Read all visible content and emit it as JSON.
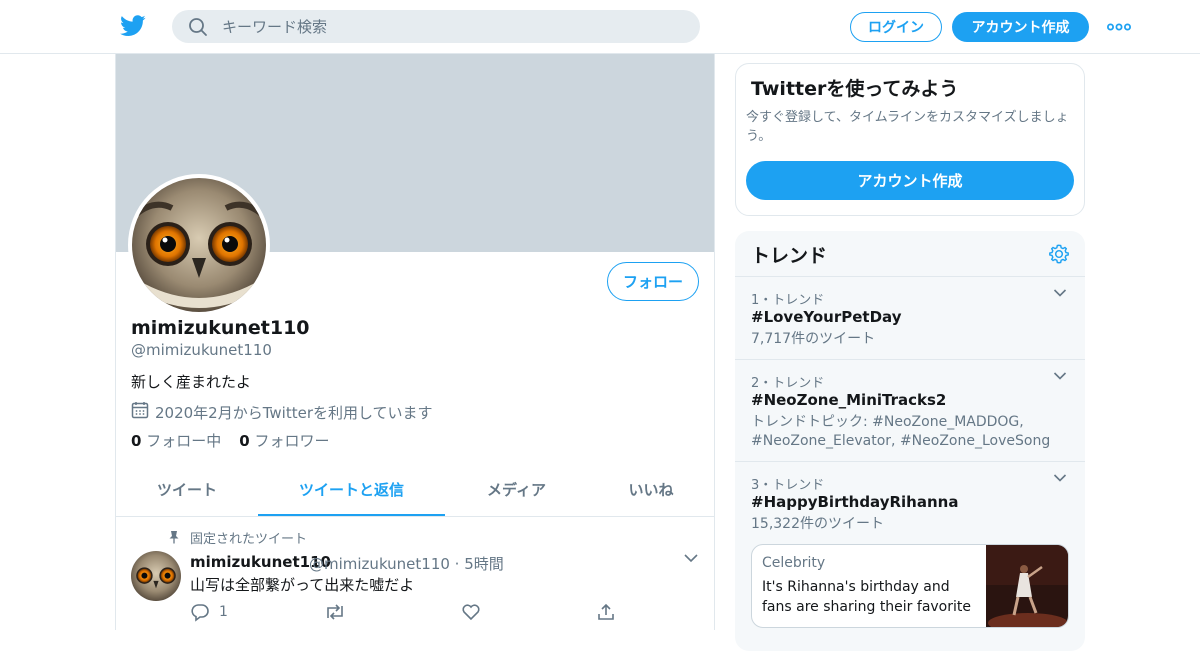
{
  "header": {
    "search_placeholder": "キーワード検索",
    "login_label": "ログイン",
    "signup_label": "アカウント作成"
  },
  "profile": {
    "display_name": "mimizukunet110",
    "handle": "@mimizukunet110",
    "bio": "新しく産まれたよ",
    "joined": "2020年2月からTwitterを利用しています",
    "following_count": "0",
    "following_label": "フォロー中",
    "followers_count": "0",
    "followers_label": "フォロワー",
    "follow_label": "フォロー"
  },
  "tabs": [
    {
      "label": "ツイート",
      "active": false
    },
    {
      "label": "ツイートと返信",
      "active": true
    },
    {
      "label": "メディア",
      "active": false
    },
    {
      "label": "いいね",
      "active": false
    }
  ],
  "tweet": {
    "pinned_label": "固定されたツイート",
    "author_name": "mimizukunet110",
    "author_meta": "@mimizukunet110 · 5時間",
    "text": "山写は全部繋がって出来た嘘だよ",
    "reply_count": "1"
  },
  "signup_card": {
    "title": "Twitterを使ってみよう",
    "description": "今すぐ登録して、タイムラインをカスタマイズしましょう。",
    "button_label": "アカウント作成"
  },
  "trends": {
    "title": "トレンド",
    "items": [
      {
        "rank": "1・トレンド",
        "name": "#LoveYourPetDay",
        "sub": "7,717件のツイート"
      },
      {
        "rank": "2・トレンド",
        "name": "#NeoZone_MiniTracks2",
        "sub": "トレンドトピック: #NeoZone_MADDOG, #NeoZone_Elevator, #NeoZone_LoveSong"
      },
      {
        "rank": "3・トレンド",
        "name": "#HappyBirthdayRihanna",
        "sub": "15,322件のツイート"
      }
    ],
    "news": {
      "category": "Celebrity",
      "text": "It's Rihanna's birthday and fans are sharing their favorite ..."
    }
  },
  "colors": {
    "accent": "#1da1f2",
    "banner": "#ccd6dd",
    "secondary_text": "#657786"
  }
}
